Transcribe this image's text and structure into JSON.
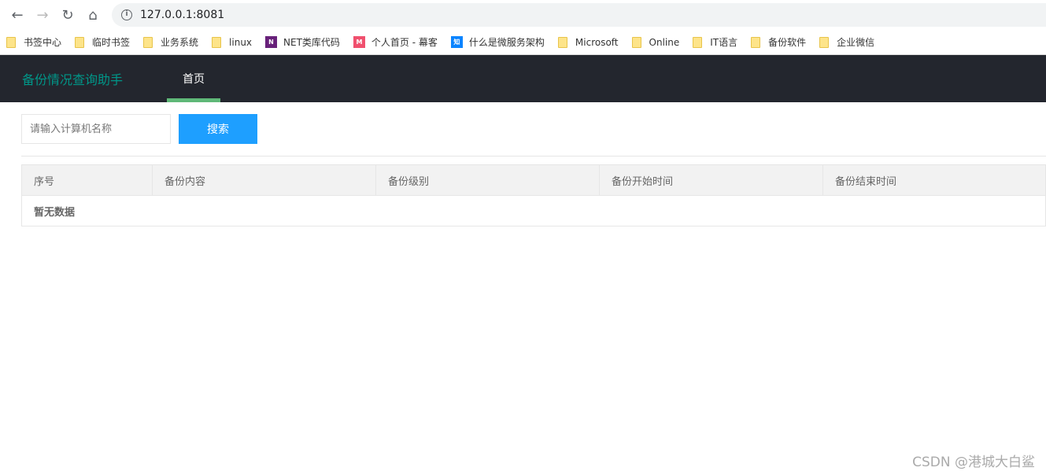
{
  "browser": {
    "url": "127.0.0.1:8081"
  },
  "bookmarks": [
    {
      "label": "书签中心",
      "icon": "folder"
    },
    {
      "label": "临时书签",
      "icon": "folder"
    },
    {
      "label": "业务系统",
      "icon": "folder"
    },
    {
      "label": "linux",
      "icon": "folder"
    },
    {
      "label": "NET类库代码",
      "icon": "net",
      "color": "#68217a"
    },
    {
      "label": "个人首页 - 幕客",
      "icon": "m",
      "color": "#f0506e"
    },
    {
      "label": "什么是微服务架构",
      "icon": "zhi",
      "color": "#0a84ff"
    },
    {
      "label": "Microsoft",
      "icon": "folder"
    },
    {
      "label": "Online",
      "icon": "folder"
    },
    {
      "label": "IT语言",
      "icon": "folder"
    },
    {
      "label": "备份软件",
      "icon": "folder"
    },
    {
      "label": "企业微信",
      "icon": "folder"
    }
  ],
  "app": {
    "title": "备份情况查询助手",
    "tab": "首页"
  },
  "search": {
    "placeholder": "请输入计算机名称",
    "button": "搜索"
  },
  "table": {
    "columns": [
      "序号",
      "备份内容",
      "备份级别",
      "备份开始时间",
      "备份结束时间"
    ],
    "empty": "暂无数据"
  },
  "watermark": "CSDN @港城大白鲨"
}
